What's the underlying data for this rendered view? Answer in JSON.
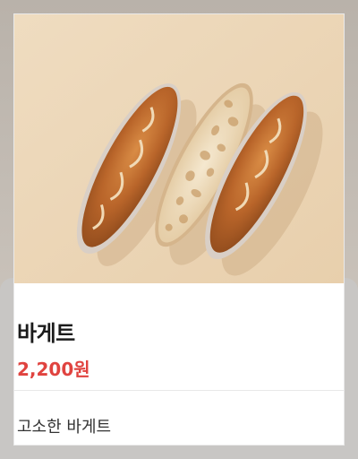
{
  "product": {
    "name": "바게트",
    "price": "2,200원",
    "description": "고소한 바게트"
  },
  "colors": {
    "price": "#e0433f",
    "image_background": "#ecd6b8"
  }
}
